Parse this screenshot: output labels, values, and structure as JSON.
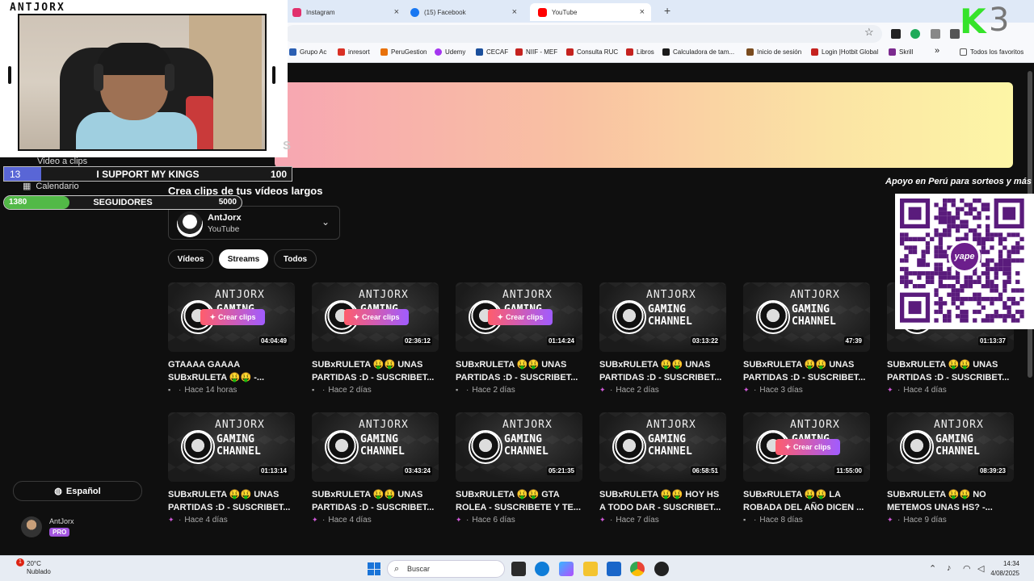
{
  "browser": {
    "tabs": [
      {
        "label": "Instagram",
        "color": "#e1306c"
      },
      {
        "label": "(15) Facebook",
        "color": "#1877f2"
      },
      {
        "label": "YouTube",
        "color": "#ff0000"
      }
    ],
    "new_tab": "+",
    "bookmarks": [
      {
        "label": "Grupo Ac",
        "color": "#2b5fb3"
      },
      {
        "label": "inresort",
        "color": "#d93025"
      },
      {
        "label": "PeruGestion",
        "color": "#e8710a"
      },
      {
        "label": "Udemy",
        "color": "#a435f0"
      },
      {
        "label": "CECAF",
        "color": "#1b4f9c"
      },
      {
        "label": "NIIF - MEF",
        "color": "#c5221f"
      },
      {
        "label": "Consulta RUC",
        "color": "#c5221f"
      },
      {
        "label": "Libros",
        "color": "#c5221f"
      },
      {
        "label": "Calculadora de tam...",
        "color": "#1a1a1a"
      },
      {
        "label": "Inicio de sesión",
        "color": "#7a4b1f"
      },
      {
        "label": "Login |Hotbit Global",
        "color": "#c5221f"
      },
      {
        "label": "Skrill",
        "color": "#7b2a8f"
      }
    ],
    "bookmarks_more": "»",
    "all_bookmarks": "Todos los favoritos"
  },
  "overlay": {
    "brand": "ANTJORX",
    "goal": {
      "current": "13",
      "title": "I SUPPORT MY KINGS",
      "target": "100",
      "progress": 0.13
    },
    "followers": {
      "current": "1380",
      "title": "SEGUIDORES",
      "target": "5000",
      "progress": 0.276
    },
    "yape_title": "Apoyo en Perú para sorteos y más",
    "yape_badge": "yape",
    "k3_letter": "K",
    "k3_number": "3"
  },
  "sidebar": {
    "partial_item": "Video a clips",
    "calendar": "Calendario",
    "language": "Español",
    "user_name": "AntJorx",
    "user_badge": "PRO",
    "stub_s": "S"
  },
  "main": {
    "section_title": "Crea clips de tus vídeos largos",
    "channel": {
      "name": "AntJorx",
      "platform": "YouTube"
    },
    "filters": [
      {
        "label": "Vídeos",
        "active": false
      },
      {
        "label": "Streams",
        "active": true
      },
      {
        "label": "Todos",
        "active": false
      }
    ],
    "thumb_brand": "ANTJORX",
    "thumb_gaming": "GAMING",
    "thumb_channel": "CHANNEL",
    "clip_label": "Crear clips",
    "videos": [
      {
        "title": "GTAAAA GAAAA SUBxRULETA 🤑🤑 -...",
        "time": "Hace 14 horas",
        "duration": "04:04:49",
        "hover": true,
        "icon": "folder"
      },
      {
        "title": "SUBxRULETA 🤑🤑 UNAS PARTIDAS :D - SUSCRIBET...",
        "time": "Hace 2 días",
        "duration": "02:36:12",
        "hover": true,
        "icon": "folder"
      },
      {
        "title": "SUBxRULETA 🤑🤑 UNAS PARTIDAS :D - SUSCRIBET...",
        "time": "Hace 2 días",
        "duration": "01:14:24",
        "hover": true,
        "icon": "folder"
      },
      {
        "title": "SUBxRULETA 🤑🤑 UNAS PARTIDAS :D - SUSCRIBET...",
        "time": "Hace 2 días",
        "duration": "03:13:22",
        "hover": false,
        "icon": "sparkle"
      },
      {
        "title": "SUBxRULETA 🤑🤑 UNAS PARTIDAS :D - SUSCRIBET...",
        "time": "Hace 3 días",
        "duration": "47:39",
        "hover": false,
        "icon": "sparkle"
      },
      {
        "title": "SUBxRULETA 🤑🤑 UNAS PARTIDAS :D - SUSCRIBET...",
        "time": "Hace 4 días",
        "duration": "01:13:37",
        "hover": false,
        "icon": "sparkle"
      },
      {
        "title": "SUBxRULETA 🤑🤑 UNAS PARTIDAS :D - SUSCRIBET...",
        "time": "Hace 4 días",
        "duration": "01:13:14",
        "hover": false,
        "icon": "sparkle"
      },
      {
        "title": "SUBxRULETA 🤑🤑 UNAS PARTIDAS :D - SUSCRIBET...",
        "time": "Hace 4 días",
        "duration": "03:43:24",
        "hover": false,
        "icon": "sparkle"
      },
      {
        "title": "SUBxRULETA 🤑🤑 GTA ROLEA - SUSCRIBETE Y TE...",
        "time": "Hace 6 días",
        "duration": "05:21:35",
        "hover": false,
        "icon": "sparkle"
      },
      {
        "title": "SUBxRULETA 🤑🤑 HOY HS A TODO DAR - SUSCRIBET...",
        "time": "Hace 7 días",
        "duration": "06:58:51",
        "hover": false,
        "icon": "sparkle"
      },
      {
        "title": "SUBxRULETA 🤑🤑 LA ROBADA DEL AÑO DICEN ...",
        "time": "Hace 8 días",
        "duration": "11:55:00",
        "hover": true,
        "icon": "folder"
      },
      {
        "title": "SUBxRULETA 🤑🤑 NO METEMOS UNAS HS? -...",
        "time": "Hace 9 días",
        "duration": "08:39:23",
        "hover": false,
        "icon": "sparkle"
      }
    ]
  },
  "taskbar": {
    "weather_badge": "1",
    "temperature": "20°C",
    "condition": "Nublado",
    "search_placeholder": "Buscar",
    "time": "14:34",
    "date": "4/08/2025"
  }
}
